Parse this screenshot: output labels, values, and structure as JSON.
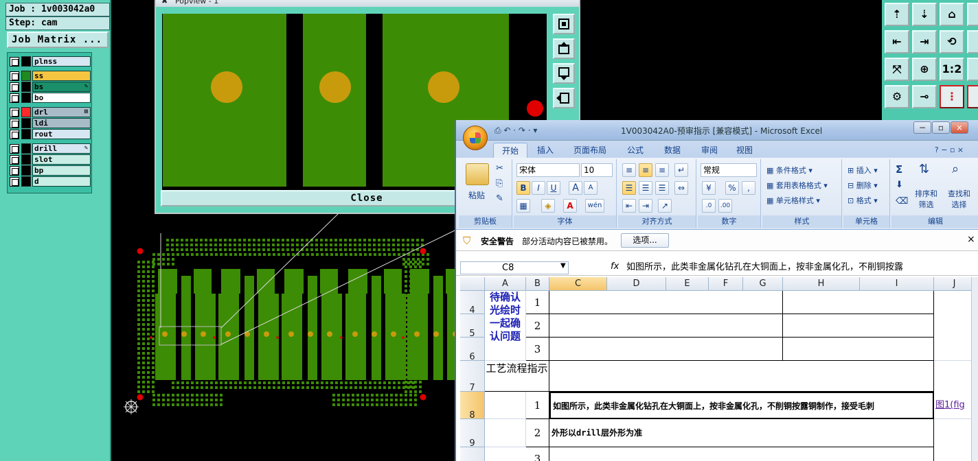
{
  "cam": {
    "job": "Job : 1v003042a0",
    "step": "Step: cam",
    "job_matrix": "Job Matrix ...",
    "layers": [
      {
        "name": "plnss",
        "color": "#000000",
        "bg": "#d6e6f2",
        "mark": ""
      },
      {
        "name": "ss",
        "color": "#1f8a1f",
        "bg": "#f5c542",
        "mark": ""
      },
      {
        "name": "bs",
        "color": "#000000",
        "bg": "#1a8f6a",
        "mark": "✎"
      },
      {
        "name": "bo",
        "color": "#000000",
        "bg": "#ffffff",
        "mark": ""
      },
      {
        "name": "drl",
        "color": "#ff2a2a",
        "bg": "#a8bcc8",
        "mark": "⊞"
      },
      {
        "name": "ldi",
        "color": "#000000",
        "bg": "#a8bcc8",
        "mark": ""
      },
      {
        "name": "rout",
        "color": "#000000",
        "bg": "#d6e6f2",
        "mark": ""
      },
      {
        "name": "drill",
        "color": "#000000",
        "bg": "#d6e6f2",
        "mark": "✎"
      },
      {
        "name": "slot",
        "color": "#000000",
        "bg": "#c8eee6",
        "mark": ""
      },
      {
        "name": "bp",
        "color": "#000000",
        "bg": "#c8eee6",
        "mark": ""
      },
      {
        "name": "d",
        "color": "#000000",
        "bg": "#c8eee6",
        "mark": ""
      }
    ],
    "popview": {
      "title": "Popview - 1",
      "close": "Close"
    },
    "right_tools": [
      "⇡",
      "⇣",
      "⌂",
      "",
      "⇤",
      "⇥",
      "⟲",
      "",
      "⤧",
      "⊕",
      "1:2",
      "",
      "⚙",
      "⊸",
      "⋮",
      "⋮"
    ],
    "colors": {
      "copper": "#3d8c05",
      "pad": "#c89b0d",
      "mark": "#e00000",
      "dots": "#3d8c05"
    }
  },
  "excel": {
    "title": "1V003042A0-预审指示 [兼容模式] - Microsoft Excel",
    "qat": "⎙ ↶ · ↷ · ▾",
    "tabs": [
      "开始",
      "插入",
      "页面布局",
      "公式",
      "数据",
      "审阅",
      "视图"
    ],
    "help": "? − ▫ ×",
    "ribbon": {
      "clipboard": {
        "paste": "粘贴",
        "label": "剪贴板"
      },
      "font": {
        "name": "宋体",
        "size": "10",
        "label": "字体",
        "bold": "B",
        "italic": "I",
        "underline": "U",
        "grow": "A",
        "shrink": "A",
        "color_a": "A",
        "wen": "wén"
      },
      "align": {
        "label": "对齐方式"
      },
      "number": {
        "format": "常规",
        "label": "数字",
        "percent": "%",
        "comma": ","
      },
      "styles": {
        "cond": "条件格式",
        "table": "套用表格格式",
        "cell": "单元格样式",
        "label": "样式"
      },
      "cells": {
        "insert": "插入",
        "delete": "删除",
        "format": "格式",
        "label": "单元格"
      },
      "editing": {
        "sigma": "Σ",
        "sort": "排序和\n筛选",
        "find": "查找和\n选择",
        "label": "编辑"
      }
    },
    "security": {
      "title": "安全警告",
      "message": "部分活动内容已被禁用。",
      "options": "选项..."
    },
    "namebox": "C8",
    "fx": "fx",
    "formula": "如图所示，此类非金属化钻孔在大铜面上，按非金属化孔，不削铜按露",
    "columns": [
      "A",
      "B",
      "C",
      "D",
      "E",
      "F",
      "G",
      "H",
      "I",
      "J"
    ],
    "rows": [
      "4",
      "5",
      "6",
      "7",
      "8",
      "9"
    ],
    "cells": {
      "a4": "待确认光绘时一起确认问题",
      "b4": "1",
      "b5": "2",
      "b6": "3",
      "a7": "工艺流程指示",
      "b8": "1",
      "c8": "如图所示，此类非金属化钻孔在大铜面上，按非金属化孔，不削铜按露铜制作，接受毛刺",
      "j8": "图1(fig",
      "b9": "2",
      "c9": "外形以drill层外形为准",
      "b10": "3"
    }
  }
}
